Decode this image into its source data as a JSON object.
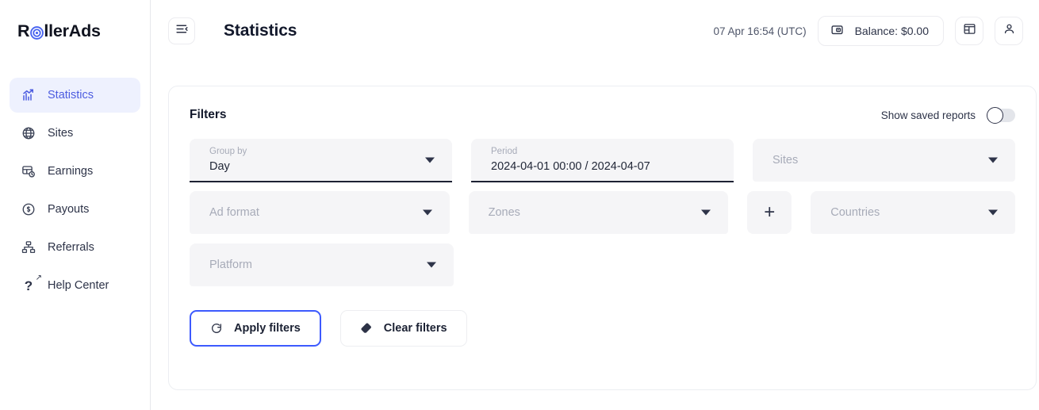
{
  "brand": {
    "name_prefix": "R",
    "name_suffix": "llerAds",
    "logo_icon": "bullseye-icon",
    "accent": "#4c5ce0"
  },
  "sidebar": {
    "items": [
      {
        "label": "Statistics",
        "icon": "bar-chart-trend-icon",
        "active": true
      },
      {
        "label": "Sites",
        "icon": "globe-icon",
        "active": false
      },
      {
        "label": "Earnings",
        "icon": "table-clock-icon",
        "active": false
      },
      {
        "label": "Payouts",
        "icon": "coin-dollar-icon",
        "active": false
      },
      {
        "label": "Referrals",
        "icon": "org-tree-icon",
        "active": false
      },
      {
        "label": "Help Center",
        "icon": "question-external-link-icon",
        "active": false
      }
    ]
  },
  "topbar": {
    "menu_icon": "collapse-menu-icon",
    "title": "Statistics",
    "clock": "07 Apr 16:54 (UTC)",
    "balance_label": "Balance: $0.00",
    "balance_icon": "wallet-icon",
    "news_icon": "news-panel-icon",
    "account_icon": "user-icon"
  },
  "filters": {
    "title": "Filters",
    "saved_reports_label": "Show saved reports",
    "saved_reports_on": false,
    "fields": [
      {
        "name": "group-by",
        "label": "Group by",
        "value": "Day",
        "placeholder": "",
        "caret": true,
        "focused": true
      },
      {
        "name": "period",
        "label": "Period",
        "value": "2024-04-01 00:00 / 2024-04-07",
        "placeholder": "",
        "caret": false,
        "focused": true
      },
      {
        "name": "sites",
        "label": "",
        "value": "",
        "placeholder": "Sites",
        "caret": true,
        "focused": false
      },
      {
        "name": "ad-format",
        "label": "",
        "value": "",
        "placeholder": "Ad format",
        "caret": true,
        "focused": false
      },
      {
        "name": "zones",
        "label": "",
        "value": "",
        "placeholder": "Zones",
        "caret": true,
        "focused": false
      },
      {
        "name": "countries",
        "label": "",
        "value": "",
        "placeholder": "Countries",
        "caret": true,
        "focused": false
      },
      {
        "name": "platform",
        "label": "",
        "value": "",
        "placeholder": "Platform",
        "caret": true,
        "focused": false
      }
    ],
    "add_filter_label": "+",
    "apply_label": "Apply filters",
    "apply_icon": "refresh-icon",
    "clear_label": "Clear filters",
    "clear_icon": "eraser-icon"
  }
}
